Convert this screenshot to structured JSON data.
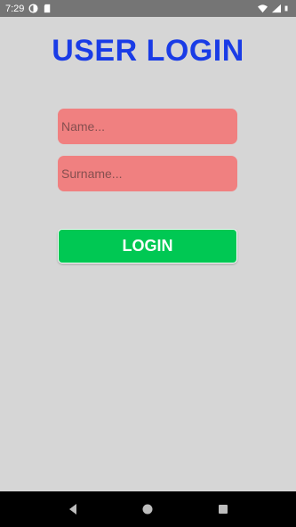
{
  "status_bar": {
    "time": "7:29",
    "icons": [
      "app-notification-icon",
      "sd-card-icon",
      "wifi-icon",
      "signal-icon",
      "battery-icon"
    ]
  },
  "login": {
    "title": "USER LOGIN",
    "name_placeholder": "Name...",
    "surname_placeholder": "Surname...",
    "button_label": "LOGIN"
  },
  "colors": {
    "background": "#d6d6d6",
    "title": "#1a3ce6",
    "field": "#f08080",
    "button": "#00c853"
  },
  "nav_bar": {
    "icons": [
      "back-icon",
      "home-icon",
      "recents-icon"
    ]
  }
}
